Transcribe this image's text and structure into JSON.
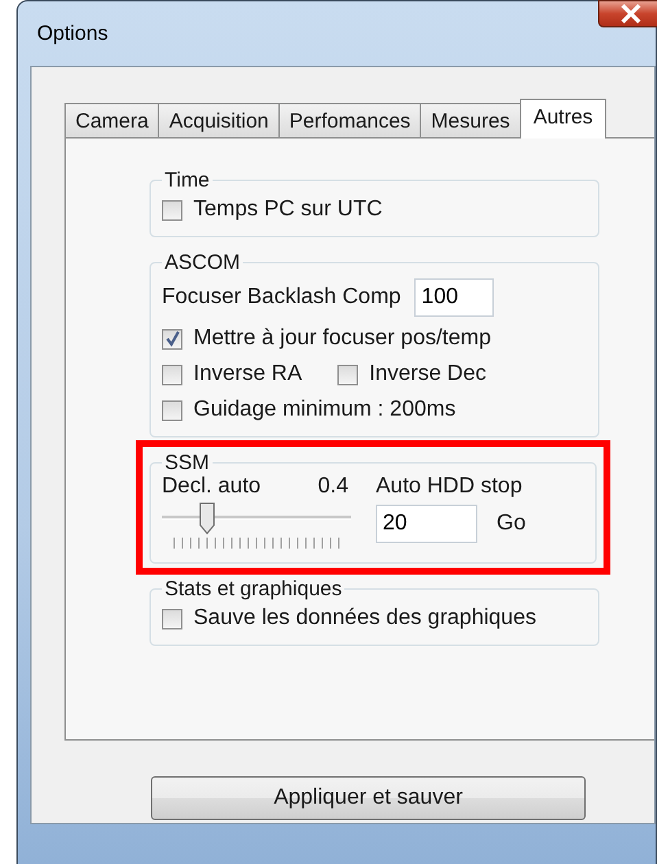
{
  "window": {
    "title": "Options"
  },
  "tabs": [
    {
      "label": "Camera",
      "selected": false
    },
    {
      "label": "Acquisition",
      "selected": false
    },
    {
      "label": "Perfomances",
      "selected": false
    },
    {
      "label": "Mesures",
      "selected": false
    },
    {
      "label": "Autres",
      "selected": true
    }
  ],
  "groups": [
    {
      "title": "Time",
      "rows": [
        {
          "kind": "checkbox",
          "label": "Temps PC sur UTC",
          "checked": false
        }
      ]
    },
    {
      "title": "ASCOM",
      "rows": [
        {
          "kind": "field",
          "label": "Focuser Backlash Comp",
          "value": "100"
        },
        {
          "kind": "checkbox",
          "label": "Mettre à jour focuser pos/temp",
          "checked": true
        },
        {
          "kind": "checkbox-pair",
          "items": [
            {
              "label": "Inverse RA",
              "checked": false
            },
            {
              "label": "Inverse Dec",
              "checked": false
            }
          ]
        },
        {
          "kind": "checkbox",
          "label": "Guidage minimum : 200ms",
          "checked": false
        }
      ]
    },
    {
      "title": "SSM",
      "highlighted": true,
      "rows": [
        {
          "kind": "slider-stop",
          "slider_label": "Decl. auto",
          "reading": "0.4",
          "level": 0.2,
          "stop_label": "Auto HDD stop",
          "stop_value": "20",
          "unit": "Go"
        }
      ]
    },
    {
      "title": "Stats et graphiques",
      "rows": [
        {
          "kind": "checkbox",
          "label": "Sauve les données des graphiques",
          "checked": false
        }
      ]
    }
  ],
  "button": "Appliquer et sauver"
}
